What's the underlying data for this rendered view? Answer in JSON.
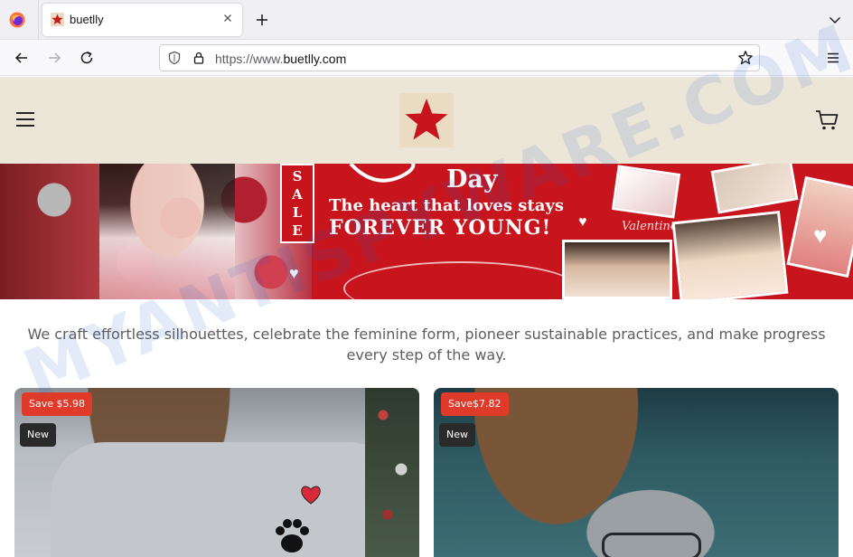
{
  "browser": {
    "tab": {
      "title": "buetlly"
    },
    "url": {
      "scheme": "https://www.",
      "domain": "buetlly.com"
    }
  },
  "site": {
    "logo_icon": "star-icon",
    "accent_color": "#c8141c",
    "header_bg": "#ece6d8"
  },
  "banner": {
    "sale": "SALE",
    "day": "Day",
    "line1": "The heart that loves stays",
    "line2": "FOREVER YOUNG!",
    "script": "Valentine's Day"
  },
  "tagline": "We craft effortless silhouettes, celebrate the feminine form, pioneer sustainable practices, and make progress every step of the way.",
  "products": [
    {
      "save": "Save $5.98",
      "tag": "New"
    },
    {
      "save": "Save$7.82",
      "tag": "New"
    }
  ],
  "watermark": "MYANTISPYWARE.COM"
}
